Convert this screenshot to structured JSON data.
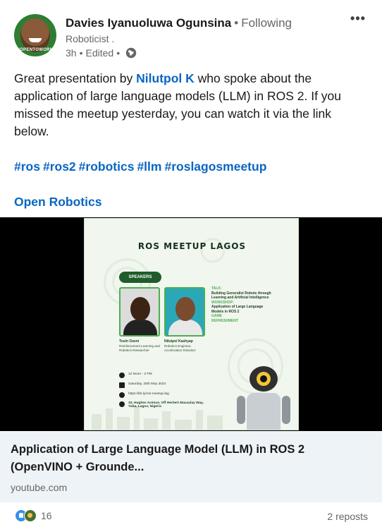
{
  "post": {
    "author": {
      "name": "Davies Iyanuoluwa Ogunsina",
      "follow_status": "Following",
      "headline": "Roboticist .",
      "time": "3h",
      "edited": "Edited",
      "avatar_text": "#OPENTOWORK"
    },
    "more_label": "•••",
    "body": {
      "before_mention": "Great presentation by ",
      "mention": "Nilutpol K",
      "after_mention": " who spoke about the application of large language models (LLM) in ROS 2. If you missed the meetup yesterday, you can watch it via the link below."
    },
    "hashtags": [
      "#ros",
      "#ros2",
      "#robotics",
      "#llm",
      "#roslagosmeetup"
    ],
    "org_link": "Open Robotics"
  },
  "poster": {
    "title": "ROS MEETUP LAGOS",
    "speakers_label": "SPEAKERS",
    "speaker1_name": "Tosin Oseni",
    "speaker1_role": "Reinforcement Learning and Robotics Researcher",
    "speaker2_name": "Nilutpol Kashyap",
    "speaker2_role": "Robotics Engineer, Acceleration Robotics",
    "talk_label": "TALK:",
    "talk_value": "Building Generalist Robots through Learning and Artificial Intelligence",
    "workshop_label": "WORKSHOP:",
    "workshop_value": "Application of Large Language Models in ROS 2",
    "game": "GAME",
    "refreshment": "REFRESHMENT",
    "time": "12 Noon - 2 PM",
    "date": "Saturday, 25th May 2024",
    "url": "https://bit.ly/ros-meetup-lag",
    "address": "10, Hughes Avenue, Off Herbert Macaulay Way, Yaba, Lagos, Nigeria"
  },
  "link_card": {
    "title": "Application of Large Language Model (LLM) in ROS 2 (OpenVINO + Grounde...",
    "domain": "youtube.com"
  },
  "social": {
    "reaction_count": "16",
    "reposts": "2 reposts"
  },
  "colors": {
    "link": "#0a66c2",
    "muted": "#666666",
    "card_bg": "#eef3f8"
  }
}
